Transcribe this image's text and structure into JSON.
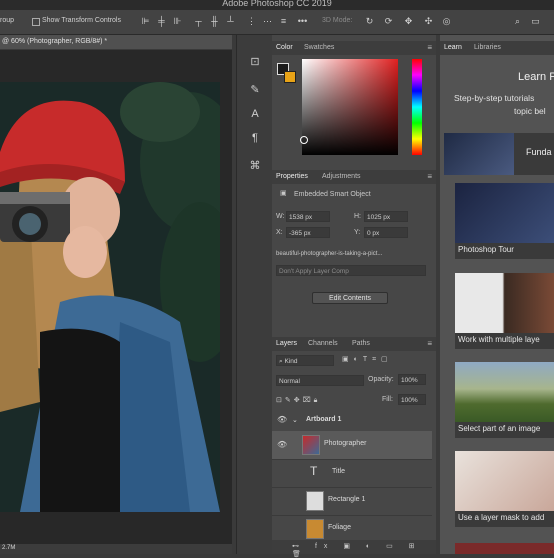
{
  "app": {
    "title": "Adobe Photoshop CC 2019"
  },
  "options_bar": {
    "tool_label": "roup",
    "show_transform": "Show Transform Controls",
    "mode_3d": "3D Mode:"
  },
  "document": {
    "tab_label": "@ 60% (Photographer, RGB/8#) *",
    "zoom": "2.7M"
  },
  "color_panel": {
    "tabs": [
      "Color",
      "Swatches"
    ]
  },
  "properties_panel": {
    "tabs": [
      "Properties",
      "Adjustments"
    ],
    "type": "Embedded Smart Object",
    "w_label": "W:",
    "w": "1538 px",
    "h_label": "H:",
    "h": "1025 px",
    "x_label": "X:",
    "x": "-365 px",
    "y_label": "Y:",
    "y": "0 px",
    "filename": "beautiful-photographer-is-taking-a-pict...",
    "layer_comp": "Don't Apply Layer Comp",
    "edit_button": "Edit Contents"
  },
  "layers_panel": {
    "tabs": [
      "Layers",
      "Channels",
      "Paths"
    ],
    "kind": "Kind",
    "blend": "Normal",
    "opacity_label": "Opacity:",
    "opacity": "100%",
    "fill_label": "Fill:",
    "fill": "100%",
    "layers": [
      {
        "name": "Artboard 1"
      },
      {
        "name": "Photographer"
      },
      {
        "name": "Title"
      },
      {
        "name": "Rectangle 1"
      },
      {
        "name": "Foliage"
      }
    ]
  },
  "learn_panel": {
    "tabs": [
      "Learn",
      "Libraries"
    ],
    "heading": "Learn P",
    "subtitle_1": "Step-by-step tutorials",
    "subtitle_2": "topic bel",
    "featured": "Funda",
    "items": [
      {
        "label": "Photoshop Tour"
      },
      {
        "label": "Work with multiple laye"
      },
      {
        "label": "Select part of an image"
      },
      {
        "label": "Use a layer mask to add"
      }
    ]
  },
  "colors": {
    "accent": "#e8a317",
    "panel": "#474747",
    "canvas_bg": "#282828"
  }
}
